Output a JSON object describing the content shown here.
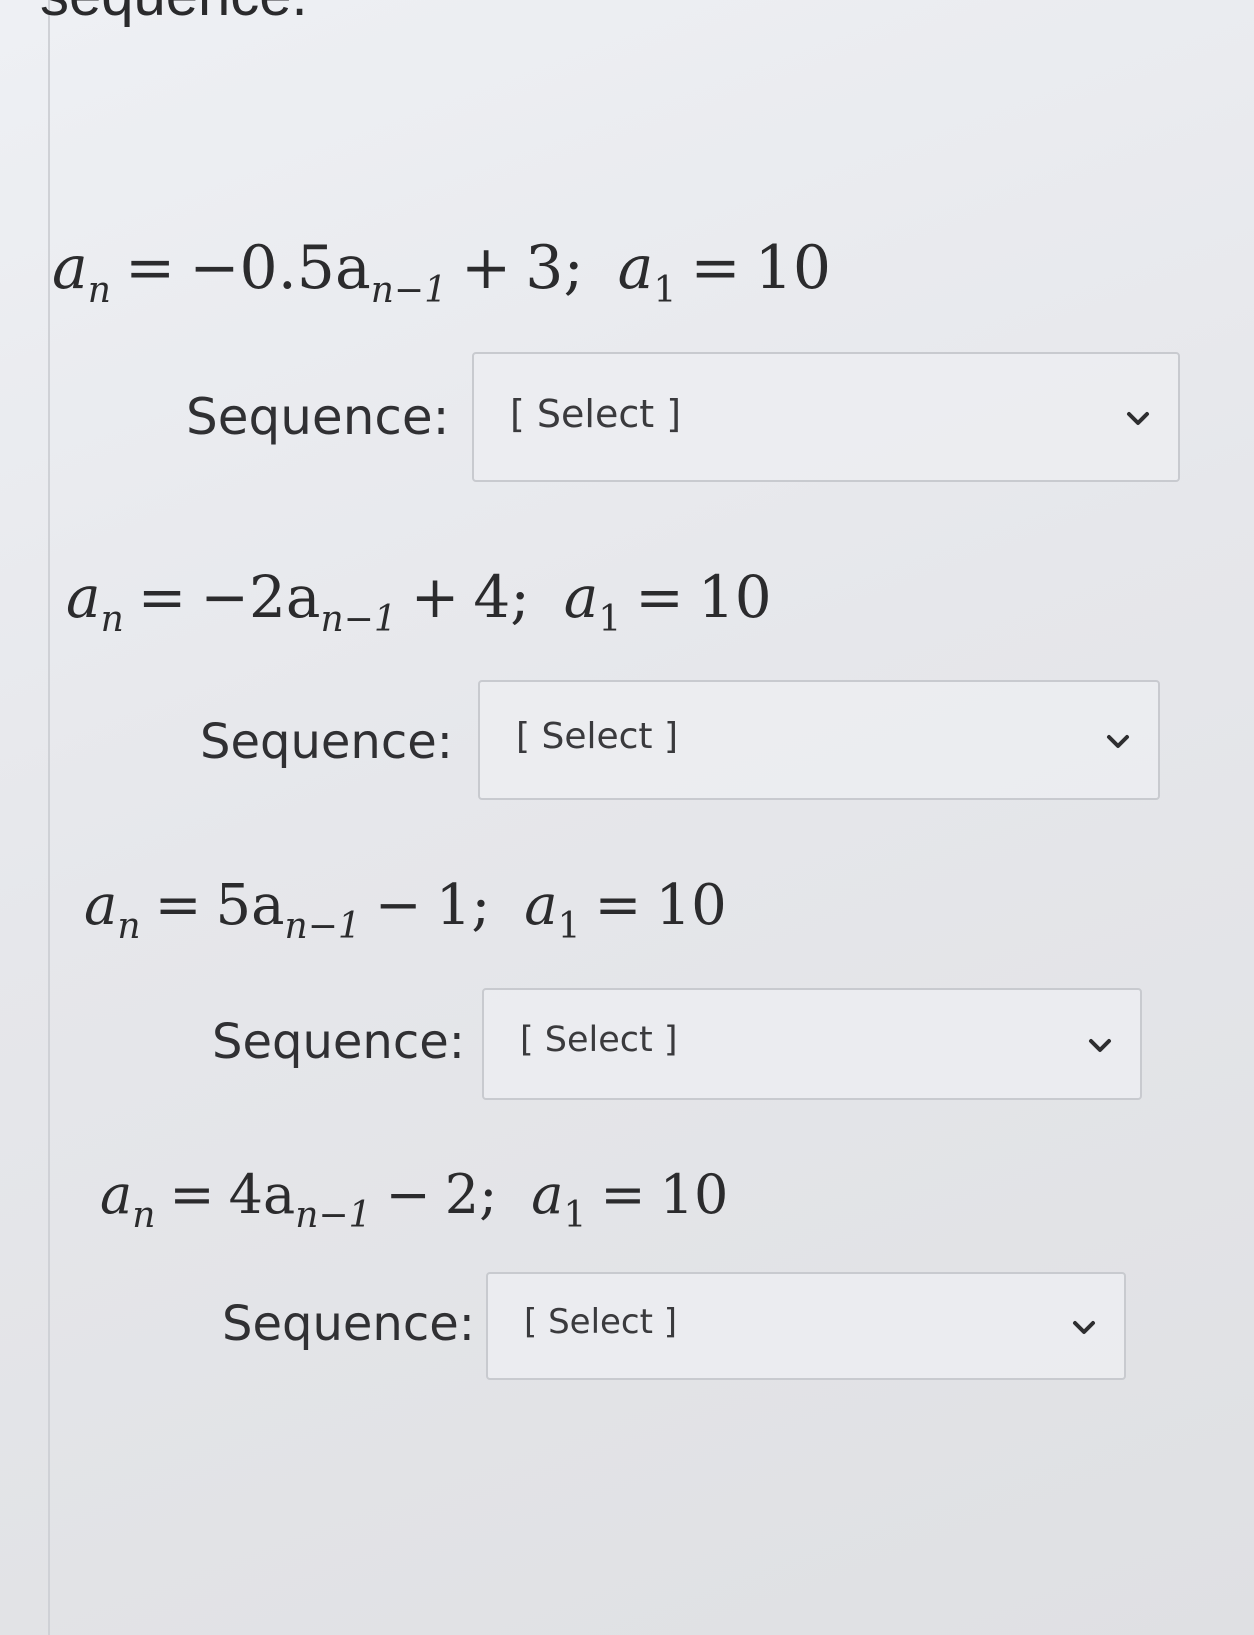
{
  "header": {
    "title_fragment": "sequence."
  },
  "problems": [
    {
      "eq_lhs_var": "a",
      "eq_lhs_sub": "n",
      "eq_coef": "−0.5a",
      "eq_sub": "n−1",
      "eq_op": "+",
      "eq_const": "3",
      "init_var": "a",
      "init_sub": "1",
      "init_val": "10",
      "label": "Sequence:",
      "select_value": "[ Select ]"
    },
    {
      "eq_lhs_var": "a",
      "eq_lhs_sub": "n",
      "eq_coef": "−2a",
      "eq_sub": "n−1",
      "eq_op": "+",
      "eq_const": "4",
      "init_var": "a",
      "init_sub": "1",
      "init_val": "10",
      "label": "Sequence:",
      "select_value": "[ Select ]"
    },
    {
      "eq_lhs_var": "a",
      "eq_lhs_sub": "n",
      "eq_coef": "5a",
      "eq_sub": "n−1",
      "eq_op": "−",
      "eq_const": "1",
      "init_var": "a",
      "init_sub": "1",
      "init_val": "10",
      "label": "Sequence:",
      "select_value": "[ Select ]"
    },
    {
      "eq_lhs_var": "a",
      "eq_lhs_sub": "n",
      "eq_coef": "4a",
      "eq_sub": "n−1",
      "eq_op": "−",
      "eq_const": "2",
      "init_var": "a",
      "init_sub": "1",
      "init_val": "10",
      "label": "Sequence:",
      "select_value": "[ Select ]"
    }
  ],
  "icons": {
    "dropdown": "chevron-down-icon"
  }
}
